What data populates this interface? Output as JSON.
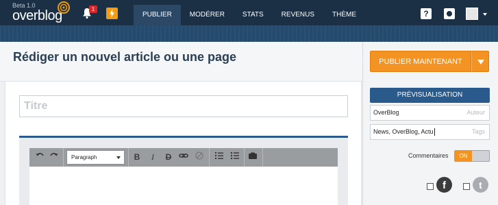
{
  "app": {
    "beta_label": "Beta 1.0",
    "logo_text": "overblog",
    "notification_count": "1",
    "colors": {
      "nav_bg": "#1b2f45",
      "accent_orange": "#f39323",
      "accent_blue": "#2a5a8c"
    }
  },
  "nav": {
    "items": [
      {
        "label": "PUBLIER",
        "active": true
      },
      {
        "label": "MODÉRER"
      },
      {
        "label": "STATS"
      },
      {
        "label": "REVENUS"
      },
      {
        "label": "THÈME"
      }
    ],
    "help_label": "?"
  },
  "page": {
    "title": "Rédiger un nouvel article ou une page"
  },
  "editor": {
    "title_placeholder": "Titre",
    "format_select": "Paragraph",
    "toolbar_icons": [
      "undo-icon",
      "redo-icon",
      "bold-icon",
      "italic-icon",
      "strikethrough-icon",
      "link-icon",
      "unlink-icon",
      "ordered-list-icon",
      "bullet-list-icon",
      "media-icon"
    ]
  },
  "sidebar": {
    "publish_label": "PUBLIER MAINTENANT",
    "preview_label": "PRÉVISUALISATION",
    "author": {
      "value": "OverBlog",
      "placeholder": "Auteur"
    },
    "tags": {
      "value": "News, OverBlog, Actu",
      "placeholder": "Tags"
    },
    "comments_label": "Commentaires",
    "comments_toggle": "ON",
    "share": [
      {
        "network": "facebook",
        "icon": "facebook-icon",
        "glyph": "f"
      },
      {
        "network": "twitter",
        "icon": "twitter-icon",
        "glyph": "t"
      }
    ]
  }
}
